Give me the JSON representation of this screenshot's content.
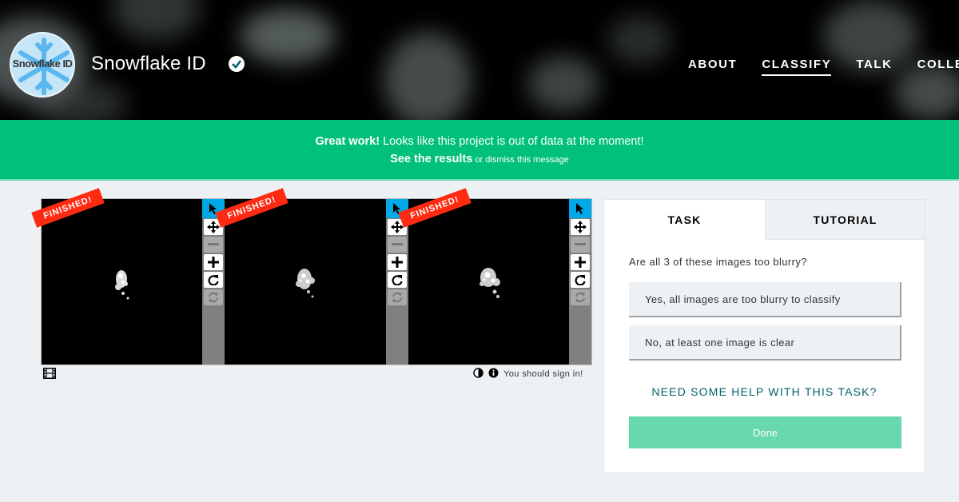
{
  "header": {
    "logo_text": "Snowflake ID",
    "project_title": "Snowflake ID",
    "nav": [
      {
        "label": "ABOUT",
        "active": false
      },
      {
        "label": "CLASSIFY",
        "active": true
      },
      {
        "label": "TALK",
        "active": false
      },
      {
        "label": "COLLECT",
        "active": false
      }
    ]
  },
  "banner": {
    "strong": "Great work!",
    "message": " Looks like this project is out of data at the moment!",
    "results_link": "See the results",
    "or_text": " or ",
    "dismiss_link": "dismiss this message"
  },
  "viewer": {
    "frames": [
      {
        "ribbon": "FINISHED!"
      },
      {
        "ribbon": "FINISHED!"
      },
      {
        "ribbon": "FINISHED!"
      }
    ],
    "tool_icons": [
      "pointer-icon",
      "move-icon",
      "zoom-out-icon",
      "zoom-in-icon",
      "rotate-icon",
      "reset-icon"
    ],
    "sign_in_text": "You should sign in!"
  },
  "panel": {
    "tabs": [
      {
        "label": "TASK",
        "active": true
      },
      {
        "label": "TUTORIAL",
        "active": false
      }
    ],
    "question": "Are all 3 of these images too blurry?",
    "answers": [
      "Yes, all images are too blurry to classify",
      "No, at least one image is clear"
    ],
    "help": "NEED SOME HELP WITH THIS TASK?",
    "done": "Done"
  },
  "colors": {
    "banner": "#00c07a",
    "ribbon": "#ff2a12",
    "done_button": "#68d8ae",
    "help_text": "#00606b",
    "selected_tool": "#00a8e8"
  }
}
